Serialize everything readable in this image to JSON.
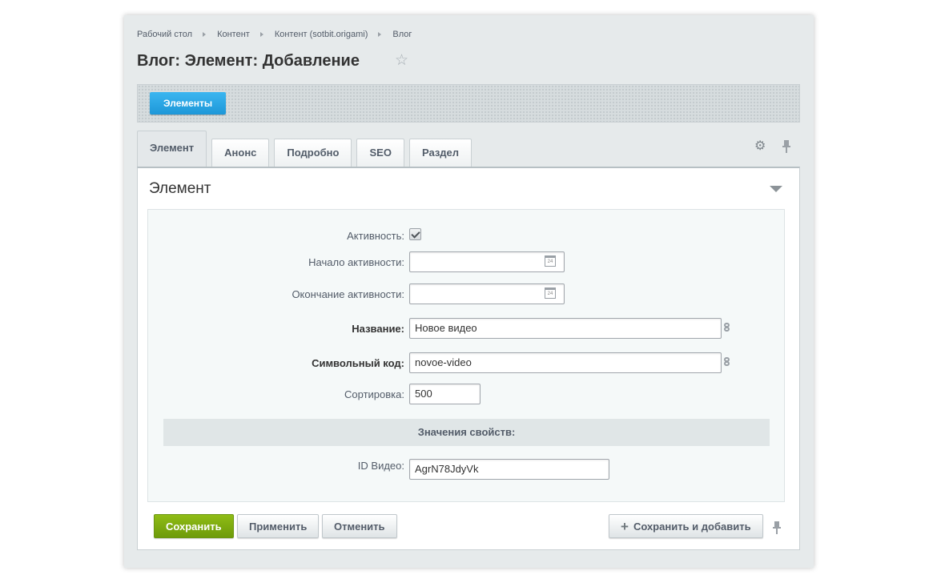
{
  "breadcrumb": [
    "Рабочий стол",
    "Контент",
    "Контент (sotbit.origami)",
    "Влог"
  ],
  "page_title": "Влог: Элемент: Добавление",
  "toolbar": {
    "elements_button": "Элементы"
  },
  "tabs": [
    "Элемент",
    "Анонс",
    "Подробно",
    "SEO",
    "Раздел"
  ],
  "section": {
    "title": "Элемент"
  },
  "form": {
    "active_label": "Активность:",
    "active_checked": true,
    "start_label": "Начало активности:",
    "start_value": "",
    "end_label": "Окончание активности:",
    "end_value": "",
    "name_label": "Название:",
    "name_value": "Новое видео",
    "code_label": "Символьный код:",
    "code_value": "novoe-video",
    "sort_label": "Сортировка:",
    "sort_value": "500",
    "props_header": "Значения свойств:",
    "video_id_label": "ID Видео:",
    "video_id_value": "AgrN78JdyVk",
    "calendar_day": "24"
  },
  "buttons": {
    "save": "Сохранить",
    "apply": "Применить",
    "cancel": "Отменить",
    "save_add": "Сохранить и добавить"
  },
  "icons": {
    "star": "star-icon",
    "gear": "gear-icon",
    "pin": "pin-icon",
    "calendar": "calendar-icon",
    "link": "link-icon",
    "plus": "plus-icon",
    "collapse": "triangle-down-icon"
  },
  "colors": {
    "accent_blue": "#1d97d8",
    "save_green": "#7aa80e"
  }
}
